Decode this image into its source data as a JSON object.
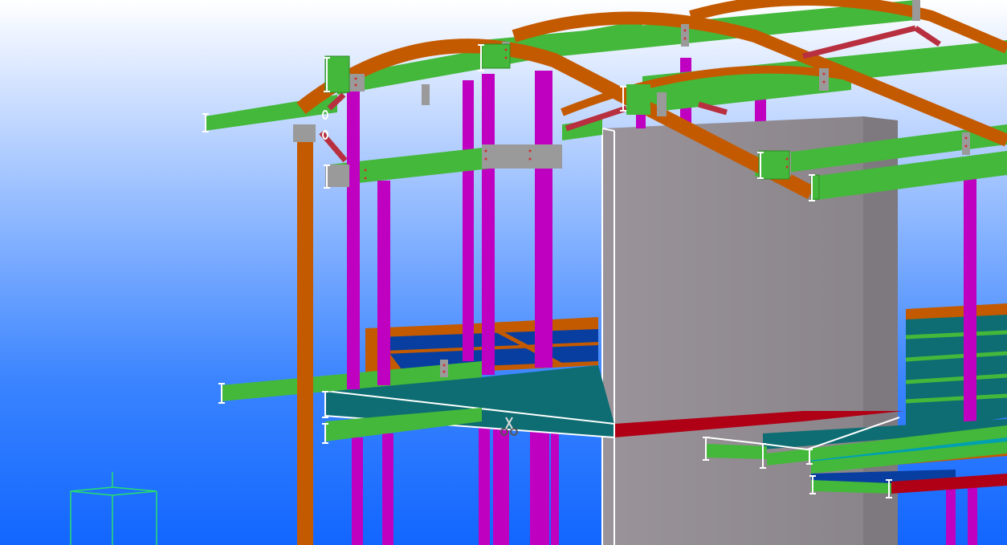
{
  "viewport": {
    "background_top": "#ffffff",
    "background_bottom": "#1266ff"
  },
  "colors": {
    "steel_beam_green": "#44b83a",
    "curved_rafter_orange": "#c45a00",
    "column_magenta": "#c000c0",
    "brace_red": "#b8303f",
    "concrete_wall_grey": "#8f8a8f",
    "slab_teal": "#0d6d72",
    "slab_blue": "#083ea0",
    "edge_red": "#b00016",
    "cut_highlight_white": "#ffffff",
    "axis_cube_green": "#28e06a"
  },
  "tools": {
    "cursor": "scissors-cut-tool"
  }
}
